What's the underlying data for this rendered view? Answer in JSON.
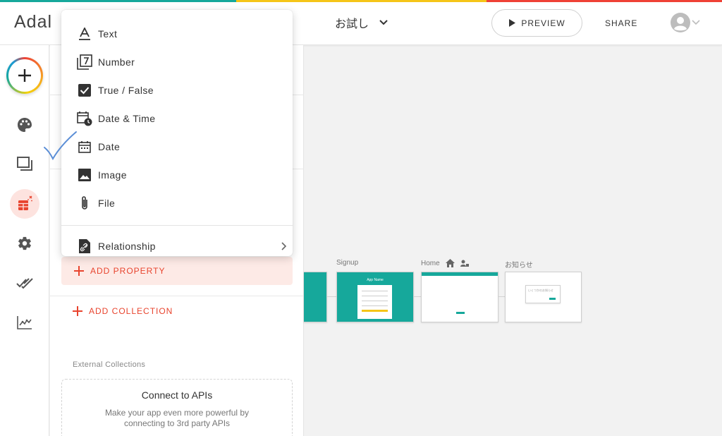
{
  "header": {
    "logo_text": "Adal",
    "app_name": "お試し",
    "preview_label": "PREVIEW",
    "share_label": "SHARE",
    "stripe_colors": [
      "#16a89b",
      "#f5c518",
      "#ef4136"
    ]
  },
  "rail": {
    "icons": [
      "add-icon",
      "palette-icon",
      "screens-icon",
      "database-icon",
      "settings-icon",
      "publish-icon",
      "analytics-icon"
    ],
    "active": "database-icon"
  },
  "panel": {
    "add_property_label": "ADD PROPERTY",
    "add_collection_label": "ADD COLLECTION",
    "external_label": "External Collections",
    "api_title": "Connect to APIs",
    "api_desc": "Make your app even more powerful by connecting to 3rd party APIs"
  },
  "menu": {
    "items": [
      {
        "label": "Text",
        "icon": "text-icon"
      },
      {
        "label": "Number",
        "icon": "number-icon"
      },
      {
        "label": "True / False",
        "icon": "checkbox-icon"
      },
      {
        "label": "Date & Time",
        "icon": "datetime-icon"
      },
      {
        "label": "Date",
        "icon": "calendar-icon"
      },
      {
        "label": "Image",
        "icon": "image-icon"
      },
      {
        "label": "File",
        "icon": "paperclip-icon"
      }
    ],
    "relationship_label": "Relationship"
  },
  "canvas": {
    "screens": [
      {
        "label": "Signup",
        "inner_title": "App Name"
      },
      {
        "label": "Home"
      },
      {
        "label": "お知らせ",
        "dialog_text": "いくつかのお知らせ"
      }
    ]
  },
  "colors": {
    "accent": "#e8442e",
    "teal": "#16a89b",
    "active_bg": "#fde3df"
  }
}
